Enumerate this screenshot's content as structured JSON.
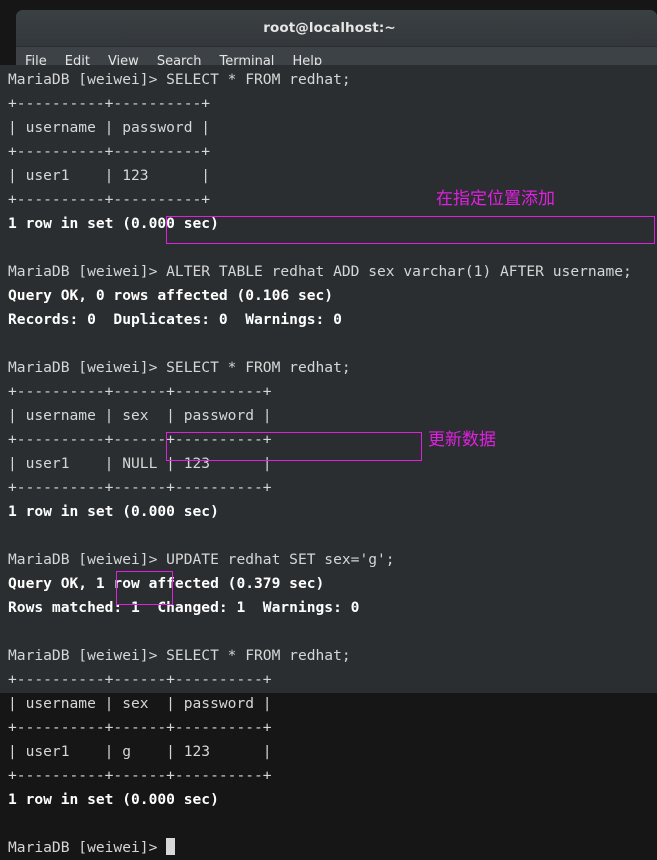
{
  "window": {
    "title": "root@localhost:~",
    "menu": [
      {
        "label": "File"
      },
      {
        "label": "Edit"
      },
      {
        "label": "View"
      },
      {
        "label": "Search"
      },
      {
        "label": "Terminal"
      },
      {
        "label": "Help"
      }
    ]
  },
  "colors": {
    "annotation": "#e020e0",
    "terminal_bg": "#2b2e30",
    "terminal_fg": "#d6d6d6",
    "titlebar_bg": "#353a3d",
    "menubar_bg": "#3c4245"
  },
  "terminal": {
    "prompt": "MariaDB [weiwei]> ",
    "lines": [
      {
        "id": "l01",
        "text": "MariaDB [weiwei]> SELECT * FROM redhat;",
        "bold": false
      },
      {
        "id": "l02",
        "text": "+----------+----------+",
        "bold": false
      },
      {
        "id": "l03",
        "text": "| username | password |",
        "bold": false
      },
      {
        "id": "l04",
        "text": "+----------+----------+",
        "bold": false
      },
      {
        "id": "l05",
        "text": "| user1    | 123      |",
        "bold": false
      },
      {
        "id": "l06",
        "text": "+----------+----------+",
        "bold": false
      },
      {
        "id": "l07",
        "text": "1 row in set (0.000 sec)",
        "bold": true
      },
      {
        "id": "l08",
        "text": "",
        "bold": false
      },
      {
        "id": "l09",
        "text": "MariaDB [weiwei]> ALTER TABLE redhat ADD sex varchar(1) AFTER username;",
        "bold": false
      },
      {
        "id": "l10",
        "text": "Query OK, 0 rows affected (0.106 sec)",
        "bold": true
      },
      {
        "id": "l11",
        "text": "Records: 0  Duplicates: 0  Warnings: 0",
        "bold": true
      },
      {
        "id": "l12",
        "text": "",
        "bold": false
      },
      {
        "id": "l13",
        "text": "MariaDB [weiwei]> SELECT * FROM redhat;",
        "bold": false
      },
      {
        "id": "l14",
        "text": "+----------+------+----------+",
        "bold": false
      },
      {
        "id": "l15",
        "text": "| username | sex  | password |",
        "bold": false
      },
      {
        "id": "l16",
        "text": "+----------+------+----------+",
        "bold": false
      },
      {
        "id": "l17",
        "text": "| user1    | NULL | 123      |",
        "bold": false
      },
      {
        "id": "l18",
        "text": "+----------+------+----------+",
        "bold": false
      },
      {
        "id": "l19",
        "text": "1 row in set (0.000 sec)",
        "bold": true
      },
      {
        "id": "l20",
        "text": "",
        "bold": false
      },
      {
        "id": "l21",
        "text": "MariaDB [weiwei]> UPDATE redhat SET sex='g';",
        "bold": false
      },
      {
        "id": "l22",
        "text": "Query OK, 1 row affected (0.379 sec)",
        "bold": true
      },
      {
        "id": "l23",
        "text": "Rows matched: 1  Changed: 1  Warnings: 0",
        "bold": true
      },
      {
        "id": "l24",
        "text": "",
        "bold": false
      },
      {
        "id": "l25",
        "text": "MariaDB [weiwei]> SELECT * FROM redhat;",
        "bold": false
      },
      {
        "id": "l26",
        "text": "+----------+------+----------+",
        "bold": false
      },
      {
        "id": "l27",
        "text": "| username | sex  | password |",
        "bold": false
      },
      {
        "id": "l28",
        "text": "+----------+------+----------+",
        "bold": false
      },
      {
        "id": "l29",
        "text": "| user1    | g    | 123      |",
        "bold": false
      },
      {
        "id": "l30",
        "text": "+----------+------+----------+",
        "bold": false
      },
      {
        "id": "l31",
        "text": "1 row in set (0.000 sec)",
        "bold": true
      },
      {
        "id": "l32",
        "text": "",
        "bold": false
      },
      {
        "id": "l33",
        "text": "MariaDB [weiwei]> ",
        "bold": false
      }
    ]
  },
  "annotations": [
    {
      "id": "a1",
      "label": "在指定位置添加",
      "target": "ALTER TABLE redhat ADD sex varchar(1) AFTER username;"
    },
    {
      "id": "a2",
      "label": "更新数据",
      "target": "UPDATE redhat SET sex='g';"
    },
    {
      "id": "a3",
      "label": "",
      "target": "g"
    }
  ]
}
